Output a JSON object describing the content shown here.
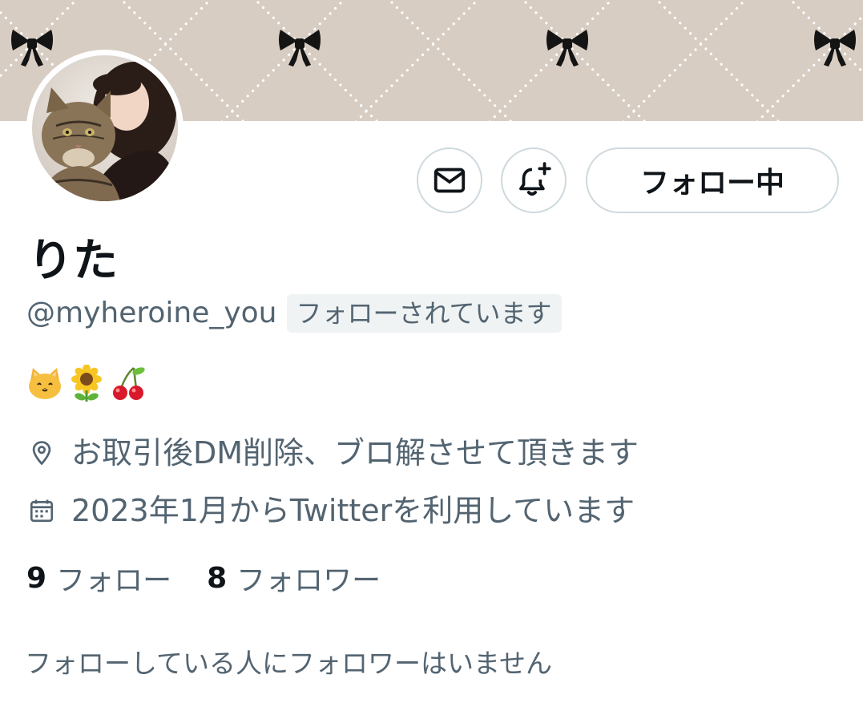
{
  "profile": {
    "name": "りた",
    "handle": "@myheroine_you",
    "follows_you_badge": "フォローされています",
    "bio_emojis": [
      "cat-face",
      "sunflower",
      "cherries"
    ],
    "location": "お取引後DM削除、ブロ解させて頂きます",
    "joined": "2023年1月からTwitterを利用しています"
  },
  "actions": {
    "follow_label": "フォロー中",
    "message_icon": "envelope-icon",
    "notify_icon": "bell-plus-icon"
  },
  "stats": {
    "following_count": "9",
    "following_label": "フォロー",
    "followers_count": "8",
    "followers_label": "フォロワー"
  },
  "mutual_text": "フォローしている人にフォロワーはいません",
  "colors": {
    "banner": "#d7cdc2",
    "secondary_text": "#536471",
    "primary_text": "#0f1419",
    "border": "#cfd9de"
  }
}
